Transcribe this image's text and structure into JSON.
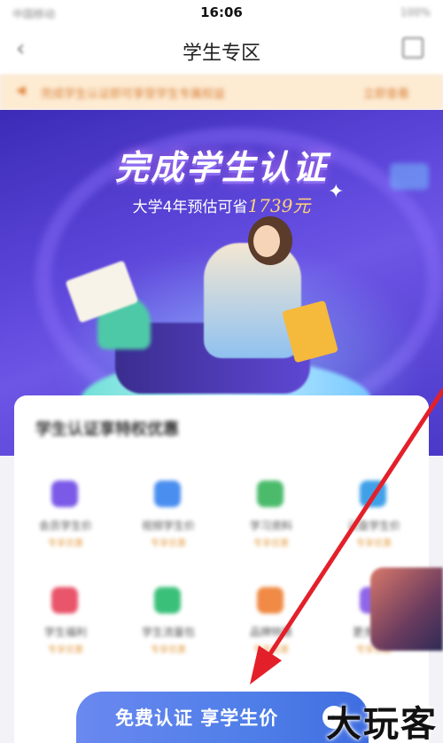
{
  "status_bar": {
    "carrier": "中国移动",
    "time": "16:06",
    "battery": "100%"
  },
  "nav": {
    "title": "学生专区"
  },
  "notice": {
    "text": "完成学生认证即可享受学生专属权益",
    "link": "立即查看"
  },
  "hero": {
    "title": "完成学生认证",
    "subtitle_prefix": "大学4年预估可省",
    "amount": "1739元"
  },
  "benefits": {
    "title": "学生认证享特权优惠",
    "items": [
      {
        "label": "会员学生价",
        "sub": "专享优惠",
        "color": "#7b5ae8"
      },
      {
        "label": "视频学生价",
        "sub": "专享优惠",
        "color": "#4a8ef0"
      },
      {
        "label": "学习资料",
        "sub": "专享优惠",
        "color": "#4bbb6b"
      },
      {
        "label": "云盘学生价",
        "sub": "专享优惠",
        "color": "#3fa0e8"
      },
      {
        "label": "学生福利",
        "sub": "专享优惠",
        "color": "#e9556a"
      },
      {
        "label": "学生流量包",
        "sub": "专享优惠",
        "color": "#3bc07a"
      },
      {
        "label": "品牌特惠",
        "sub": "专享优惠",
        "color": "#f08a45"
      },
      {
        "label": "更多权益",
        "sub": "专享优惠",
        "color": "#8f66e8"
      }
    ]
  },
  "cta": {
    "label": "免费认证 享学生价"
  },
  "watermark": {
    "text": "大玩客"
  },
  "colors": {
    "hero_purple": "#5a44d8",
    "cta_blue": "#4f7ee8",
    "annotation_red": "#e3202a",
    "accent_gold": "#ffd27a"
  }
}
